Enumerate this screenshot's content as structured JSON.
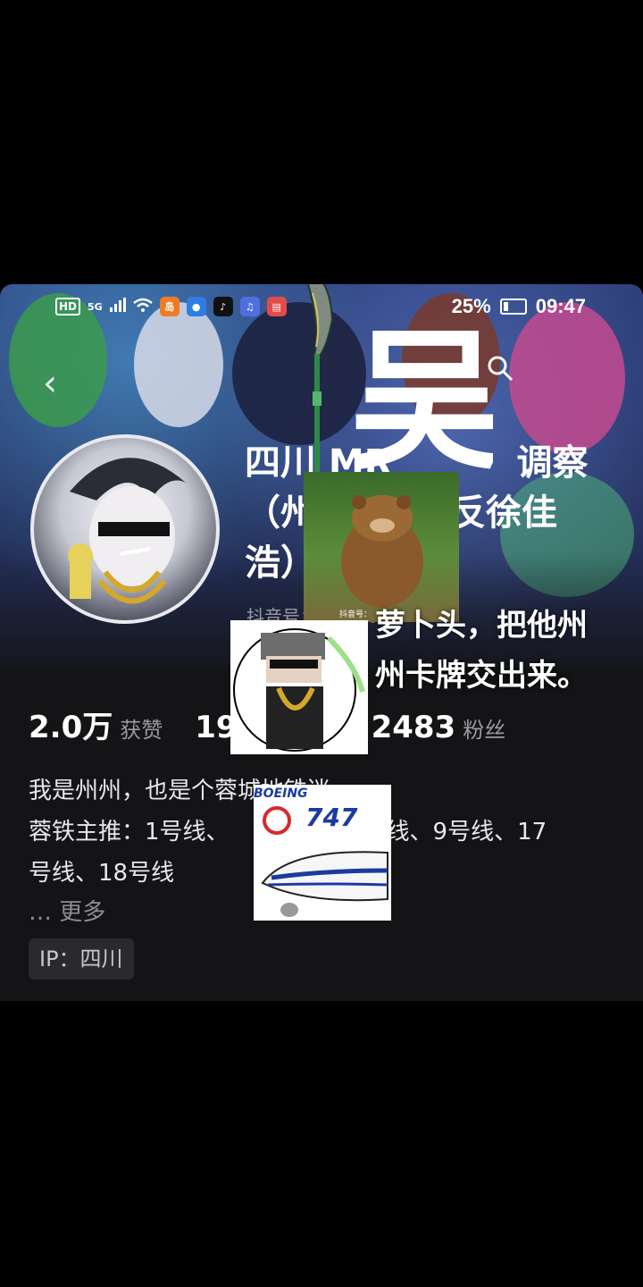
{
  "status_bar": {
    "network": "HD",
    "signal": "5G",
    "battery": "25%",
    "time": "09:47"
  },
  "profile": {
    "nickname_line1": "四川 MR",
    "nickname_line1b": "调察",
    "nickname_line2a": "（州",
    "nickname_line2b": "反徐佳",
    "nickname_line3": "浩）",
    "douyin_id": "抖音号：…369…",
    "avatar_icon": "anime-avatar-with-sunglasses"
  },
  "stats": {
    "likes_value": "2.0万",
    "likes_label": "获赞",
    "following_value": "19",
    "followers_value": "2483",
    "followers_label": "粉丝"
  },
  "bio": {
    "line1": "我是州州，也是个蓉城地铁迷",
    "line2a": "蓉铁主推：1号线、",
    "line2b": "号线、9号线、17",
    "line3": "号线、18号线",
    "more_label": "… 更多",
    "ip_label": "IP：四川"
  },
  "overlay": {
    "caption_line1": "萝卜头，把他州",
    "caption_line2": "州卡牌交出来。",
    "sticker_747_text": "747",
    "sticker_boeing_text": "BOEING",
    "sticker_bear_watermark": "抖音号：",
    "big_char": "吴"
  },
  "colors": {
    "banner": "#283567",
    "background": "#141416",
    "accent_red": "#d42b2b",
    "boeing_blue": "#1c3aa0"
  }
}
